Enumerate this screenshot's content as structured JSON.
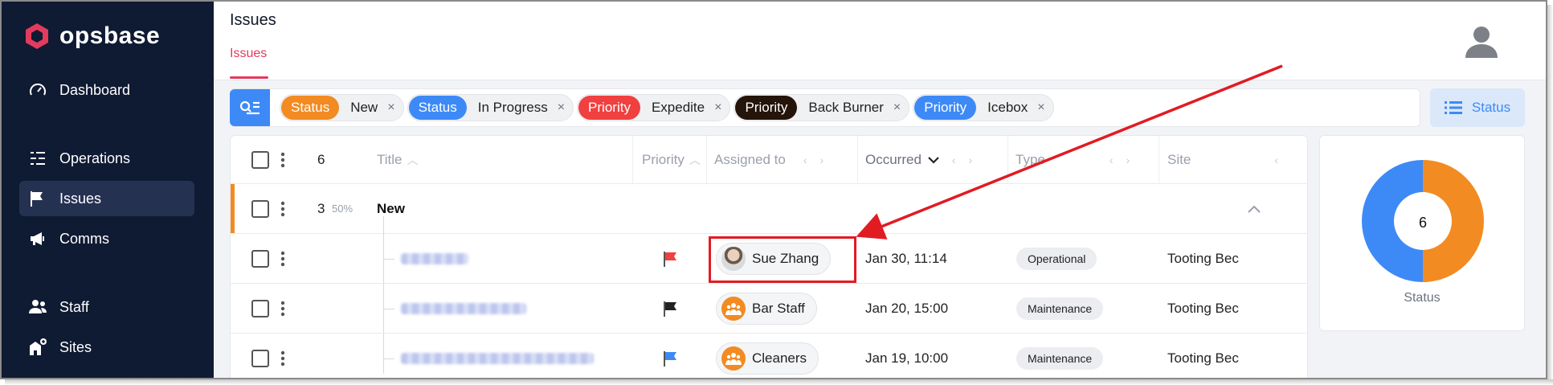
{
  "app": {
    "name": "opsbase",
    "brand_color": "#e23b5c"
  },
  "sidebar": {
    "items": [
      {
        "label": "Dashboard",
        "icon": "gauge-icon"
      },
      {
        "label": "Operations",
        "icon": "list-lines-icon"
      },
      {
        "label": "Issues",
        "icon": "flag-icon",
        "active": true
      },
      {
        "label": "Comms",
        "icon": "megaphone-icon"
      },
      {
        "label": "Staff",
        "icon": "people-icon"
      },
      {
        "label": "Sites",
        "icon": "building-plus-icon"
      }
    ]
  },
  "header": {
    "title": "Issues",
    "tabs": [
      {
        "label": "Issues",
        "active": true
      }
    ]
  },
  "filters": [
    {
      "key": "Status",
      "value": "New",
      "color": "#f28b22"
    },
    {
      "key": "Status",
      "value": "In Progress",
      "color": "#3d8af7"
    },
    {
      "key": "Priority",
      "value": "Expedite",
      "color": "#f04040"
    },
    {
      "key": "Priority",
      "value": "Back Burner",
      "color": "#24140a"
    },
    {
      "key": "Priority",
      "value": "Icebox",
      "color": "#3d8af7"
    }
  ],
  "filter_remove_glyph": "×",
  "group_by_button": {
    "label": "Status"
  },
  "table": {
    "count": "6",
    "columns": [
      "Title",
      "Priority",
      "Assigned to",
      "Occurred",
      "Type",
      "Site"
    ],
    "group": {
      "count": "3",
      "percent": "50%",
      "label": "New"
    },
    "rows": [
      {
        "priority_flag_color": "#f04040",
        "assignee": "Sue Zhang",
        "assignee_kind": "person",
        "occurred": "Jan 30, 11:14",
        "type": "Operational",
        "site": "Tooting Bec"
      },
      {
        "priority_flag_color": "#222222",
        "assignee": "Bar Staff",
        "assignee_kind": "team",
        "occurred": "Jan 20, 15:00",
        "type": "Maintenance",
        "site": "Tooting Bec"
      },
      {
        "priority_flag_color": "#3d8af7",
        "assignee": "Cleaners",
        "assignee_kind": "team",
        "occurred": "Jan 19, 10:00",
        "type": "Maintenance",
        "site": "Tooting Bec"
      }
    ]
  },
  "status_chart": {
    "label": "Status",
    "total": "6",
    "chart_data": {
      "type": "pie",
      "categories": [
        "New",
        "In Progress"
      ],
      "values": [
        3,
        3
      ],
      "colors": [
        "#f28b22",
        "#3d8af7"
      ]
    }
  },
  "annotation": {
    "color": "#e11b22"
  }
}
